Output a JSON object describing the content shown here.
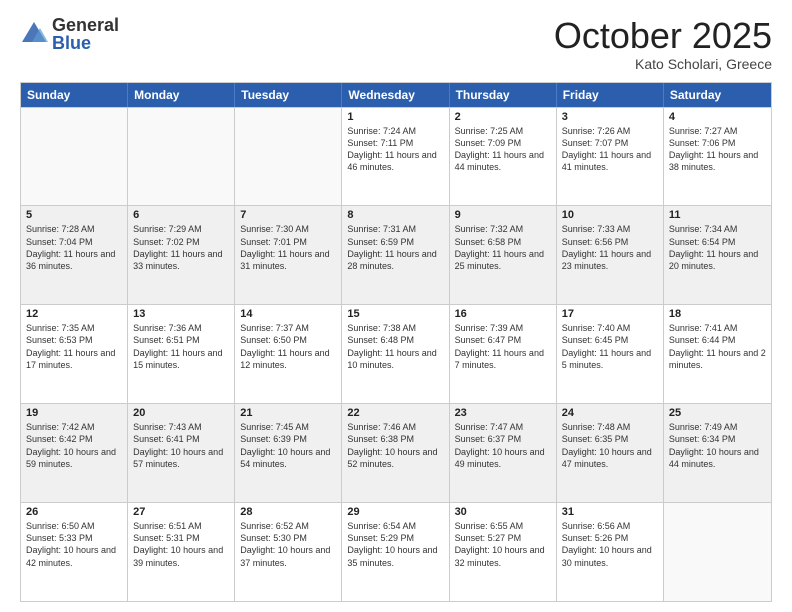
{
  "logo": {
    "general": "General",
    "blue": "Blue"
  },
  "title": "October 2025",
  "location": "Kato Scholari, Greece",
  "days": [
    "Sunday",
    "Monday",
    "Tuesday",
    "Wednesday",
    "Thursday",
    "Friday",
    "Saturday"
  ],
  "rows": [
    [
      {
        "day": "",
        "info": "",
        "empty": true
      },
      {
        "day": "",
        "info": "",
        "empty": true
      },
      {
        "day": "",
        "info": "",
        "empty": true
      },
      {
        "day": "1",
        "info": "Sunrise: 7:24 AM\nSunset: 7:11 PM\nDaylight: 11 hours\nand 46 minutes."
      },
      {
        "day": "2",
        "info": "Sunrise: 7:25 AM\nSunset: 7:09 PM\nDaylight: 11 hours\nand 44 minutes."
      },
      {
        "day": "3",
        "info": "Sunrise: 7:26 AM\nSunset: 7:07 PM\nDaylight: 11 hours\nand 41 minutes."
      },
      {
        "day": "4",
        "info": "Sunrise: 7:27 AM\nSunset: 7:06 PM\nDaylight: 11 hours\nand 38 minutes."
      }
    ],
    [
      {
        "day": "5",
        "info": "Sunrise: 7:28 AM\nSunset: 7:04 PM\nDaylight: 11 hours\nand 36 minutes.",
        "shaded": true
      },
      {
        "day": "6",
        "info": "Sunrise: 7:29 AM\nSunset: 7:02 PM\nDaylight: 11 hours\nand 33 minutes.",
        "shaded": true
      },
      {
        "day": "7",
        "info": "Sunrise: 7:30 AM\nSunset: 7:01 PM\nDaylight: 11 hours\nand 31 minutes.",
        "shaded": true
      },
      {
        "day": "8",
        "info": "Sunrise: 7:31 AM\nSunset: 6:59 PM\nDaylight: 11 hours\nand 28 minutes.",
        "shaded": true
      },
      {
        "day": "9",
        "info": "Sunrise: 7:32 AM\nSunset: 6:58 PM\nDaylight: 11 hours\nand 25 minutes.",
        "shaded": true
      },
      {
        "day": "10",
        "info": "Sunrise: 7:33 AM\nSunset: 6:56 PM\nDaylight: 11 hours\nand 23 minutes.",
        "shaded": true
      },
      {
        "day": "11",
        "info": "Sunrise: 7:34 AM\nSunset: 6:54 PM\nDaylight: 11 hours\nand 20 minutes.",
        "shaded": true
      }
    ],
    [
      {
        "day": "12",
        "info": "Sunrise: 7:35 AM\nSunset: 6:53 PM\nDaylight: 11 hours\nand 17 minutes."
      },
      {
        "day": "13",
        "info": "Sunrise: 7:36 AM\nSunset: 6:51 PM\nDaylight: 11 hours\nand 15 minutes."
      },
      {
        "day": "14",
        "info": "Sunrise: 7:37 AM\nSunset: 6:50 PM\nDaylight: 11 hours\nand 12 minutes."
      },
      {
        "day": "15",
        "info": "Sunrise: 7:38 AM\nSunset: 6:48 PM\nDaylight: 11 hours\nand 10 minutes."
      },
      {
        "day": "16",
        "info": "Sunrise: 7:39 AM\nSunset: 6:47 PM\nDaylight: 11 hours\nand 7 minutes."
      },
      {
        "day": "17",
        "info": "Sunrise: 7:40 AM\nSunset: 6:45 PM\nDaylight: 11 hours\nand 5 minutes."
      },
      {
        "day": "18",
        "info": "Sunrise: 7:41 AM\nSunset: 6:44 PM\nDaylight: 11 hours\nand 2 minutes."
      }
    ],
    [
      {
        "day": "19",
        "info": "Sunrise: 7:42 AM\nSunset: 6:42 PM\nDaylight: 10 hours\nand 59 minutes.",
        "shaded": true
      },
      {
        "day": "20",
        "info": "Sunrise: 7:43 AM\nSunset: 6:41 PM\nDaylight: 10 hours\nand 57 minutes.",
        "shaded": true
      },
      {
        "day": "21",
        "info": "Sunrise: 7:45 AM\nSunset: 6:39 PM\nDaylight: 10 hours\nand 54 minutes.",
        "shaded": true
      },
      {
        "day": "22",
        "info": "Sunrise: 7:46 AM\nSunset: 6:38 PM\nDaylight: 10 hours\nand 52 minutes.",
        "shaded": true
      },
      {
        "day": "23",
        "info": "Sunrise: 7:47 AM\nSunset: 6:37 PM\nDaylight: 10 hours\nand 49 minutes.",
        "shaded": true
      },
      {
        "day": "24",
        "info": "Sunrise: 7:48 AM\nSunset: 6:35 PM\nDaylight: 10 hours\nand 47 minutes.",
        "shaded": true
      },
      {
        "day": "25",
        "info": "Sunrise: 7:49 AM\nSunset: 6:34 PM\nDaylight: 10 hours\nand 44 minutes.",
        "shaded": true
      }
    ],
    [
      {
        "day": "26",
        "info": "Sunrise: 6:50 AM\nSunset: 5:33 PM\nDaylight: 10 hours\nand 42 minutes."
      },
      {
        "day": "27",
        "info": "Sunrise: 6:51 AM\nSunset: 5:31 PM\nDaylight: 10 hours\nand 39 minutes."
      },
      {
        "day": "28",
        "info": "Sunrise: 6:52 AM\nSunset: 5:30 PM\nDaylight: 10 hours\nand 37 minutes."
      },
      {
        "day": "29",
        "info": "Sunrise: 6:54 AM\nSunset: 5:29 PM\nDaylight: 10 hours\nand 35 minutes."
      },
      {
        "day": "30",
        "info": "Sunrise: 6:55 AM\nSunset: 5:27 PM\nDaylight: 10 hours\nand 32 minutes."
      },
      {
        "day": "31",
        "info": "Sunrise: 6:56 AM\nSunset: 5:26 PM\nDaylight: 10 hours\nand 30 minutes."
      },
      {
        "day": "",
        "info": "",
        "empty": true
      }
    ]
  ]
}
